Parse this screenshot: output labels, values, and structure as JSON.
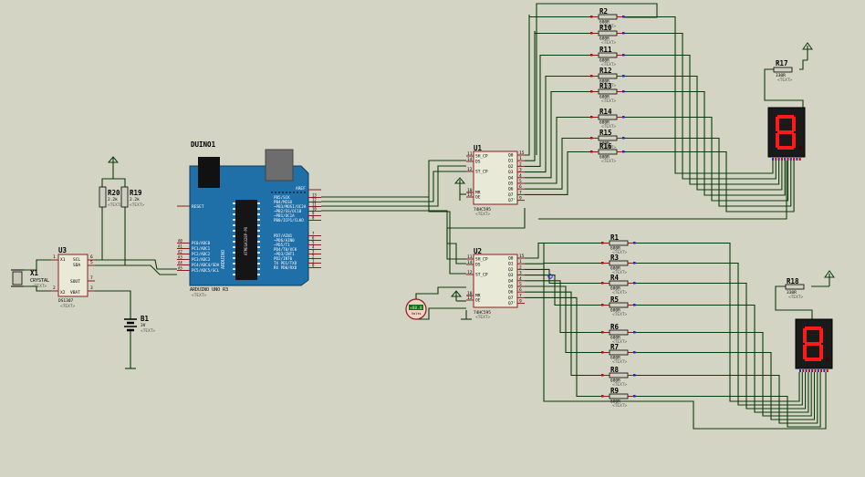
{
  "arduino": {
    "ref": "DUINO1",
    "part": "ARDUINO UNO R3",
    "chip_text": "ATMEGA328P-PU",
    "reset": "RESET",
    "aref": "AREF",
    "pins_right": [
      "PB5/SCK",
      "PB4/MISO",
      "~PB3/MOSI/OC2A",
      "~PB2/SS/OC1B",
      "~PB1/OC1A",
      "PB0/ICP1/CLKO",
      "PD7/AIN1",
      "~PD6/AIN0",
      "~PD5/T1",
      "PD4/T0/XCK",
      "~PD3/INT1",
      "PD2/INT0",
      "TX PD1/TXD",
      "RX PD0/RXD"
    ],
    "pins_left": [
      "PC0/ADC0",
      "PC1/ADC1",
      "PC2/ADC2",
      "PC3/ADC3",
      "PC4/ADC4/SDA",
      "PC5/ADC5/SCL"
    ],
    "nums_right": [
      "13",
      "12",
      "11",
      "10",
      "9",
      "8",
      "7",
      "6",
      "5",
      "4",
      "3",
      "2",
      "1",
      "0"
    ],
    "nums_left": [
      "A0",
      "A1",
      "A2",
      "A3",
      "A4",
      "A5"
    ]
  },
  "ds1307": {
    "ref": "U3",
    "part": "DS1307",
    "pins_l": [
      "X1",
      "X2"
    ],
    "pins_r": [
      "SCL",
      "SDA",
      "SOUT",
      "VBAT"
    ],
    "nums_l": [
      "1",
      "2"
    ],
    "nums_r": [
      "6",
      "5",
      "7",
      "3"
    ]
  },
  "crystal": {
    "ref": "X1",
    "part": "CRYSTAL"
  },
  "battery": {
    "ref": "B1",
    "value": "3V"
  },
  "pullups": [
    {
      "ref": "R20",
      "value": "2.2k"
    },
    {
      "ref": "R19",
      "value": "2.2k"
    }
  ],
  "u1": {
    "ref": "U1",
    "part": "74HC595",
    "pins_l": [
      "SH_CP",
      "DS",
      "ST_CP",
      "MR",
      "OE"
    ],
    "nums_l": [
      "11",
      "14",
      "12",
      "10",
      "13"
    ],
    "pins_r": [
      "Q0",
      "Q1",
      "Q2",
      "Q3",
      "Q4",
      "Q5",
      "Q6",
      "Q7",
      "Q7'"
    ],
    "nums_r": [
      "15",
      "1",
      "2",
      "3",
      "4",
      "5",
      "6",
      "7",
      "9"
    ]
  },
  "u2": {
    "ref": "U2",
    "part": "74HC595",
    "pins_l": [
      "SH_CP",
      "DS",
      "ST_CP",
      "MR",
      "OE"
    ],
    "nums_l": [
      "11",
      "14",
      "12",
      "10",
      "13"
    ],
    "pins_r": [
      "Q0",
      "Q1",
      "Q2",
      "Q3",
      "Q4",
      "Q5",
      "Q6",
      "Q7",
      "Q7'"
    ],
    "nums_r": [
      "15",
      "1",
      "2",
      "3",
      "4",
      "5",
      "6",
      "7",
      "9"
    ]
  },
  "top_resistors": [
    {
      "ref": "R2",
      "value": "680R"
    },
    {
      "ref": "R10",
      "value": "680R"
    },
    {
      "ref": "R11",
      "value": "680R"
    },
    {
      "ref": "R12",
      "value": "680R"
    },
    {
      "ref": "R13",
      "value": "680R"
    },
    {
      "ref": "R14",
      "value": "680R"
    },
    {
      "ref": "R15",
      "value": "680R"
    },
    {
      "ref": "R16",
      "value": "680R"
    }
  ],
  "bottom_resistors": [
    {
      "ref": "R1",
      "value": "680R"
    },
    {
      "ref": "R3",
      "value": "680R"
    },
    {
      "ref": "R4",
      "value": "680R"
    },
    {
      "ref": "R5",
      "value": "680R"
    },
    {
      "ref": "R6",
      "value": "680R"
    },
    {
      "ref": "R7",
      "value": "680R"
    },
    {
      "ref": "R8",
      "value": "680R"
    },
    {
      "ref": "R9",
      "value": "680R"
    }
  ],
  "r17": {
    "ref": "R17",
    "value": "330R"
  },
  "r18": {
    "ref": "R18",
    "value": "330R"
  },
  "lamp": {
    "value": "+88.8",
    "unit": "Volts"
  },
  "display_glyph": "8",
  "text_placeholder": "<TEXT>",
  "colors": {
    "background": "#d4d4c4",
    "wire": "#0b3b0b",
    "pin": "#8a1e1e",
    "pin_dot_red": "#d20000",
    "pin_dot_blue": "#1a2bd6",
    "arduino_board": "#1f6fa8",
    "segment_on": "#ff1a1a",
    "display_body": "#1a1a1a"
  }
}
